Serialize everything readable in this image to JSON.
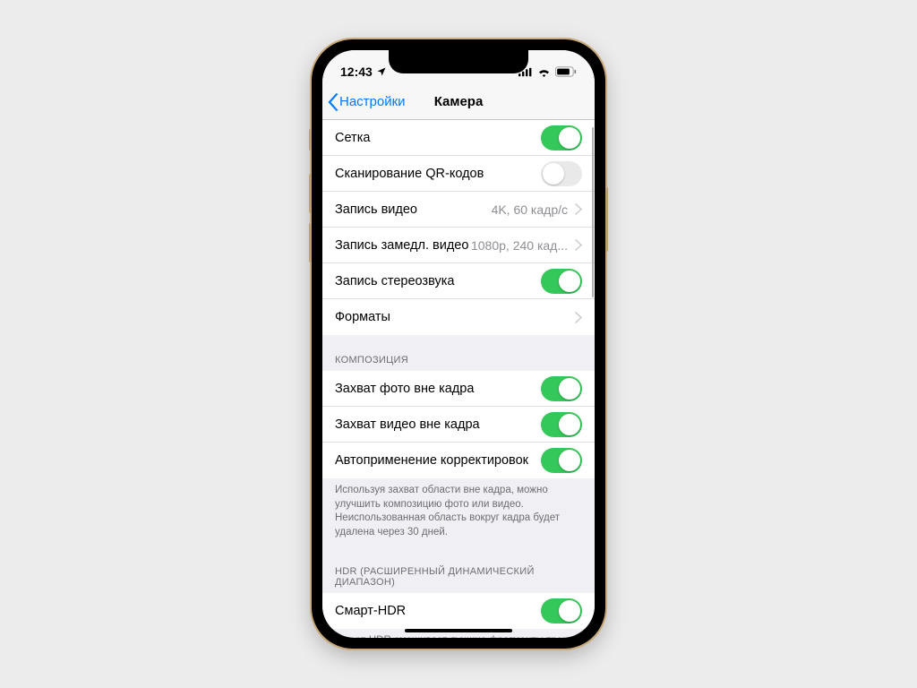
{
  "status": {
    "time": "12:43",
    "location_icon": "location-arrow",
    "signal_icon": "cellular-bars",
    "wifi_icon": "wifi",
    "battery_icon": "battery"
  },
  "nav": {
    "back_label": "Настройки",
    "title": "Камера"
  },
  "group1": [
    {
      "label": "Сетка",
      "type": "toggle",
      "on": true
    },
    {
      "label": "Сканирование QR-кодов",
      "type": "toggle",
      "on": false
    },
    {
      "label": "Запись видео",
      "type": "link",
      "value": "4K, 60 кадр/с"
    },
    {
      "label": "Запись замедл. видео",
      "type": "link",
      "value": "1080p, 240 кад..."
    },
    {
      "label": "Запись стереозвука",
      "type": "toggle",
      "on": true
    },
    {
      "label": "Форматы",
      "type": "link",
      "value": ""
    }
  ],
  "section_comp": {
    "header": "КОМПОЗИЦИЯ",
    "rows": [
      {
        "label": "Захват фото вне кадра",
        "on": true
      },
      {
        "label": "Захват видео вне кадра",
        "on": true
      },
      {
        "label": "Автоприменение корректировок",
        "on": true
      }
    ],
    "footer": "Используя захват области вне кадра, можно улучшить композицию фото или видео. Неиспользованная область вокруг кадра будет удалена через 30 дней."
  },
  "section_hdr": {
    "header": "HDR (РАСШИРЕННЫЙ ДИНАМИЧЕСКИЙ ДИАПАЗОН)",
    "rows": [
      {
        "label": "Смарт-HDR",
        "on": true
      }
    ],
    "footer": "Смарт-HDR смешивает лучшие фрагменты трех отдельных экспозиций в единую фотографию."
  }
}
